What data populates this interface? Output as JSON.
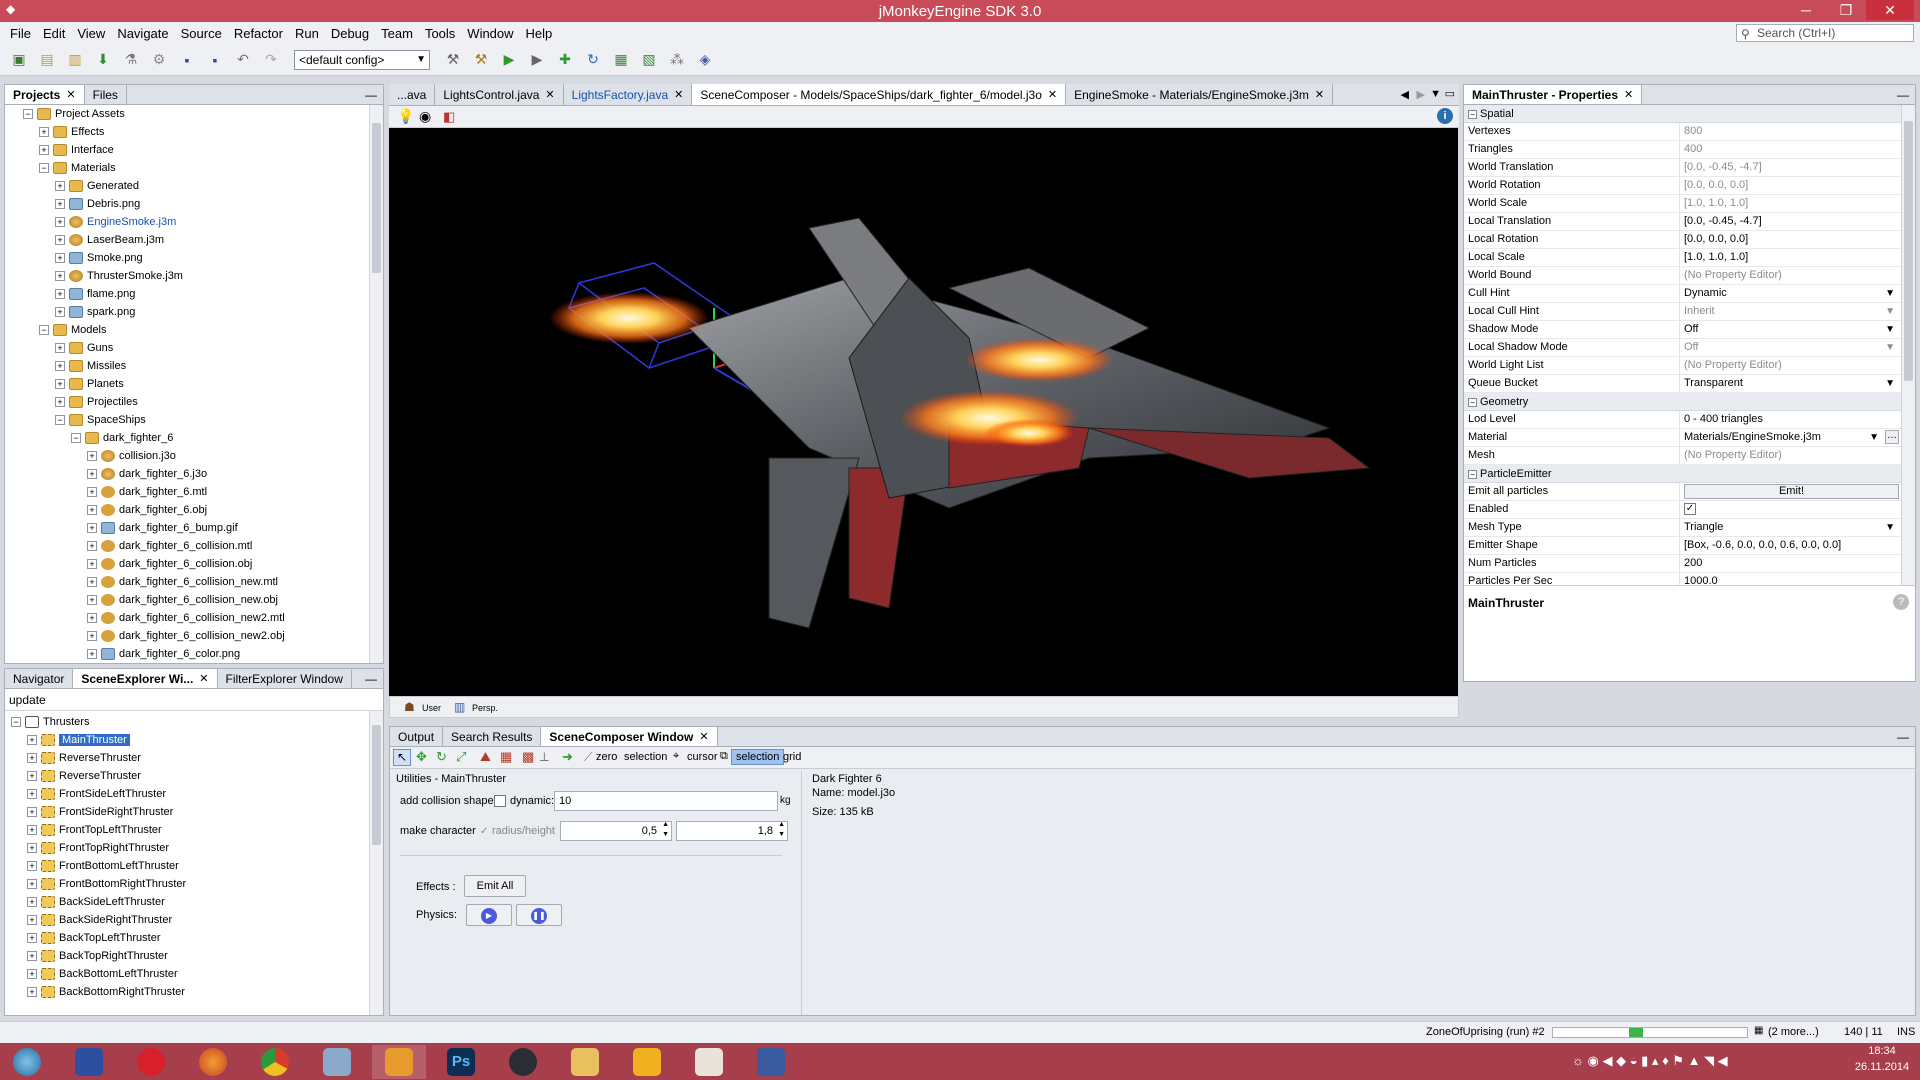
{
  "window": {
    "title": "jMonkeyEngine SDK 3.0",
    "minimize": "─",
    "maximize": "❐",
    "close": "✕"
  },
  "menu": [
    "File",
    "Edit",
    "View",
    "Navigate",
    "Source",
    "Refactor",
    "Run",
    "Debug",
    "Team",
    "Tools",
    "Window",
    "Help"
  ],
  "search": {
    "placeholder": "Search (Ctrl+I)"
  },
  "toolbar": {
    "config": "<default config>"
  },
  "projects": {
    "tabs": [
      {
        "label": "Projects"
      },
      {
        "label": "Files"
      }
    ],
    "tree": [
      {
        "label": "Project Assets",
        "indent": 0,
        "icon": "folder",
        "exp": "−"
      },
      {
        "label": "Effects",
        "indent": 1,
        "icon": "folder",
        "exp": "+"
      },
      {
        "label": "Interface",
        "indent": 1,
        "icon": "folder",
        "exp": "+"
      },
      {
        "label": "Materials",
        "indent": 1,
        "icon": "folder",
        "exp": "−"
      },
      {
        "label": "Generated",
        "indent": 2,
        "icon": "folder",
        "exp": "+"
      },
      {
        "label": "Debris.png",
        "indent": 2,
        "icon": "img",
        "exp": "+"
      },
      {
        "label": "EngineSmoke.j3m",
        "indent": 2,
        "icon": "mat",
        "exp": "+",
        "highlight": true
      },
      {
        "label": "LaserBeam.j3m",
        "indent": 2,
        "icon": "mat",
        "exp": "+"
      },
      {
        "label": "Smoke.png",
        "indent": 2,
        "icon": "img",
        "exp": "+"
      },
      {
        "label": "ThrusterSmoke.j3m",
        "indent": 2,
        "icon": "mat",
        "exp": "+"
      },
      {
        "label": "flame.png",
        "indent": 2,
        "icon": "img",
        "exp": "+"
      },
      {
        "label": "spark.png",
        "indent": 2,
        "icon": "img",
        "exp": "+"
      },
      {
        "label": "Models",
        "indent": 1,
        "icon": "folder",
        "exp": "−"
      },
      {
        "label": "Guns",
        "indent": 2,
        "icon": "folder",
        "exp": "+"
      },
      {
        "label": "Missiles",
        "indent": 2,
        "icon": "folder",
        "exp": "+"
      },
      {
        "label": "Planets",
        "indent": 2,
        "icon": "folder",
        "exp": "+"
      },
      {
        "label": "Projectiles",
        "indent": 2,
        "icon": "folder",
        "exp": "+"
      },
      {
        "label": "SpaceShips",
        "indent": 2,
        "icon": "folder",
        "exp": "−"
      },
      {
        "label": "dark_fighter_6",
        "indent": 3,
        "icon": "folder",
        "exp": "−"
      },
      {
        "label": "collision.j3o",
        "indent": 4,
        "icon": "mat",
        "exp": "+"
      },
      {
        "label": "dark_fighter_6.j3o",
        "indent": 4,
        "icon": "mat",
        "exp": "+"
      },
      {
        "label": "dark_fighter_6.mtl",
        "indent": 4,
        "icon": "obj",
        "exp": "+"
      },
      {
        "label": "dark_fighter_6.obj",
        "indent": 4,
        "icon": "obj",
        "exp": "+"
      },
      {
        "label": "dark_fighter_6_bump.gif",
        "indent": 4,
        "icon": "img",
        "exp": "+"
      },
      {
        "label": "dark_fighter_6_collision.mtl",
        "indent": 4,
        "icon": "obj",
        "exp": "+"
      },
      {
        "label": "dark_fighter_6_collision.obj",
        "indent": 4,
        "icon": "obj",
        "exp": "+"
      },
      {
        "label": "dark_fighter_6_collision_new.mtl",
        "indent": 4,
        "icon": "obj",
        "exp": "+"
      },
      {
        "label": "dark_fighter_6_collision_new.obj",
        "indent": 4,
        "icon": "obj",
        "exp": "+"
      },
      {
        "label": "dark_fighter_6_collision_new2.mtl",
        "indent": 4,
        "icon": "obj",
        "exp": "+"
      },
      {
        "label": "dark_fighter_6_collision_new2.obj",
        "indent": 4,
        "icon": "obj",
        "exp": "+"
      },
      {
        "label": "dark_fighter_6_color.png",
        "indent": 4,
        "icon": "img",
        "exp": "+"
      }
    ]
  },
  "editorTabs": [
    {
      "label": "...ava",
      "active": false
    },
    {
      "label": "LightsControl.java",
      "active": false
    },
    {
      "label": "LightsFactory.java",
      "active": false,
      "link": true
    },
    {
      "label": "SceneComposer - Models/SpaceShips/dark_fighter_6/model.j3o",
      "active": true
    },
    {
      "label": "EngineSmoke - Materials/EngineSmoke.j3m",
      "active": false
    }
  ],
  "viewportBar": {
    "user": "User",
    "persp": "Persp."
  },
  "scene": {
    "tabs": [
      {
        "label": "Navigator"
      },
      {
        "label": "SceneExplorer Wi..."
      },
      {
        "label": "FilterExplorer Window"
      }
    ],
    "filter": "update",
    "parent": "Thrusters",
    "items": [
      "MainThruster",
      "ReverseThruster",
      "ReverseThruster",
      "FrontSideLeftThruster",
      "FrontSideRightThruster",
      "FrontTopLeftThruster",
      "FrontTopRightThruster",
      "FrontBottomLeftThruster",
      "FrontBottomRightThruster",
      "BackSideLeftThruster",
      "BackSideRightThruster",
      "BackTopLeftThruster",
      "BackTopRightThruster",
      "BackBottomLeftThruster",
      "BackBottomRightThruster"
    ]
  },
  "properties": {
    "title": "MainThruster - Properties",
    "rows": [
      {
        "section": "Spatial"
      },
      {
        "k": "Vertexes",
        "v": "800",
        "ro": true
      },
      {
        "k": "Triangles",
        "v": "400",
        "ro": true
      },
      {
        "k": "World Translation",
        "v": "[0.0, -0.45, -4.7]",
        "ro": true
      },
      {
        "k": "World Rotation",
        "v": "[0.0, 0.0, 0.0]",
        "ro": true
      },
      {
        "k": "World Scale",
        "v": "[1.0, 1.0, 1.0]",
        "ro": true
      },
      {
        "k": "Local Translation",
        "v": "[0.0, -0.45, -4.7]"
      },
      {
        "k": "Local Rotation",
        "v": "[0.0, 0.0, 0.0]"
      },
      {
        "k": "Local Scale",
        "v": "[1.0, 1.0, 1.0]"
      },
      {
        "k": "World Bound",
        "v": "(No Property Editor)",
        "ro": true
      },
      {
        "k": "Cull Hint",
        "v": "Dynamic",
        "dd": true
      },
      {
        "k": "Local Cull Hint",
        "v": "Inherit",
        "ro": true,
        "dd": true
      },
      {
        "k": "Shadow Mode",
        "v": "Off",
        "dd": true
      },
      {
        "k": "Local Shadow Mode",
        "v": "Off",
        "ro": true,
        "dd": true
      },
      {
        "k": "World Light List",
        "v": "(No Property Editor)",
        "ro": true
      },
      {
        "k": "Queue Bucket",
        "v": "Transparent",
        "dd": true
      },
      {
        "section": "Geometry"
      },
      {
        "k": "Lod Level",
        "v": "0 - 400 triangles"
      },
      {
        "k": "Material",
        "v": "Materials/EngineSmoke.j3m",
        "dd": true,
        "more": true
      },
      {
        "k": "Mesh",
        "v": "(No Property Editor)",
        "ro": true
      },
      {
        "section": "ParticleEmitter"
      },
      {
        "k": "Emit all particles",
        "button": "Emit!"
      },
      {
        "k": "Enabled",
        "check": true
      },
      {
        "k": "Mesh Type",
        "v": "Triangle",
        "dd": true
      },
      {
        "k": "Emitter Shape",
        "v": "[Box, -0.6, 0.0, 0.0, 0.6, 0.0, 0.0]"
      },
      {
        "k": "Num Particles",
        "v": "200"
      },
      {
        "k": "Particles Per Sec",
        "v": "1000.0"
      }
    ],
    "description": "MainThruster"
  },
  "bottom": {
    "tabs": [
      {
        "label": "Output"
      },
      {
        "label": "Search Results"
      },
      {
        "label": "SceneComposer Window"
      }
    ],
    "tools": {
      "zero": "zero",
      "selection": "selection",
      "cursor": "cursor",
      "selection2": "selection",
      "grid": "grid"
    },
    "utilities": "Utilities - MainThruster",
    "addCollision": "add collision shape",
    "dynamic": "dynamic:",
    "mass": "10",
    "kg": "kg",
    "makeCharacter": "make character",
    "radiusHeight": "radius/height",
    "radius": "0,5",
    "height": "1,8",
    "effects": "Effects :",
    "emitAll": "Emit All",
    "physics": "Physics:",
    "info": {
      "name": "Dark Fighter 6",
      "file": "Name: model.j3o",
      "size": "Size: 135 kB"
    }
  },
  "status": {
    "run": "ZoneOfUprising (run) #2",
    "more": "(2 more...)",
    "pos": "140 | 11",
    "mode": "INS",
    "progress": 0.12
  },
  "taskbar": {
    "time": "18:34",
    "date": "26.11.2014",
    "ps": "Ps"
  }
}
